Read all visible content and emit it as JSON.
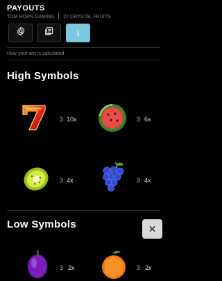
{
  "header": {
    "title": "PAYOUTS",
    "provider": "TOM HORN GAMING",
    "game": "27 CRYSTAL FRUITS"
  },
  "tabs": [
    {
      "name": "settings",
      "icon": "gear-icon",
      "active": false
    },
    {
      "name": "paytable",
      "icon": "list-icon",
      "active": false
    },
    {
      "name": "info",
      "icon": "info-icon",
      "label": "i",
      "active": true
    }
  ],
  "note": "How your win is calculated",
  "sections": {
    "high": {
      "title": "High Symbols",
      "symbols": [
        {
          "name": "seven",
          "count": "3",
          "multiplier": "10x"
        },
        {
          "name": "watermelon",
          "count": "3",
          "multiplier": "6x"
        },
        {
          "name": "kiwi",
          "count": "3",
          "multiplier": "4x"
        },
        {
          "name": "grapes",
          "count": "3",
          "multiplier": "4x"
        }
      ]
    },
    "low": {
      "title": "Low Symbols",
      "symbols": [
        {
          "name": "plum",
          "count": "3",
          "multiplier": "2x"
        },
        {
          "name": "orange",
          "count": "3",
          "multiplier": "2x"
        }
      ]
    }
  },
  "close": {
    "icon": "close-icon",
    "label": "✕"
  },
  "colors": {
    "accent": "#7cc8e0",
    "background": "#000000",
    "muted_text": "#8a8a8a"
  }
}
